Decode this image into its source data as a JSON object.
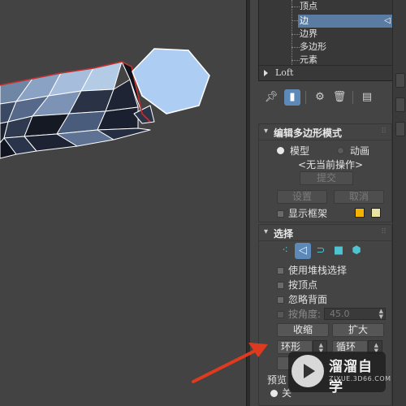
{
  "modifier_stack": {
    "items": [
      {
        "label": "顶点",
        "selected": false
      },
      {
        "label": "边",
        "selected": true
      },
      {
        "label": "边界",
        "selected": false
      },
      {
        "label": "多边形",
        "selected": false
      },
      {
        "label": "元素",
        "selected": false
      }
    ],
    "base_object": "Loft"
  },
  "toolbar": {
    "icons": [
      "pin-stack-icon",
      "show-end-result-icon",
      "make-unique-icon",
      "remove-modifier-icon",
      "configure-modifier-sets-icon"
    ]
  },
  "edit_poly_mode": {
    "title": "编辑多边形模式",
    "model_label": "模型",
    "model_selected": true,
    "animate_label": "动画",
    "no_current_operation": "<无当前操作>",
    "commit_label": "提交",
    "settings_label": "设置",
    "cancel_label": "取消",
    "show_cage_label": "显示框架",
    "cage_colors": [
      "#f5b301",
      "#e8e3a0"
    ]
  },
  "selection": {
    "title": "选择",
    "mode_icons": [
      "vertex-mode-icon",
      "edge-mode-icon",
      "border-mode-icon",
      "polygon-mode-icon",
      "element-mode-icon"
    ],
    "active_mode": "edge",
    "use_stack_selection": "使用堆栈选择",
    "by_vertex": "按顶点",
    "ignore_backfacing": "忽略背面",
    "by_angle": "按角度:",
    "angle_value": "45.0",
    "shrink_label": "收缩",
    "grow_label": "扩大",
    "ring_label": "环形",
    "loop_label": "循环",
    "preview_label": "预览",
    "off_label": "关"
  },
  "watermark": {
    "title": "溜溜自学",
    "subtitle": "ZIXUE.3D66.COM"
  },
  "colors": {
    "viewport_bg": "#434343",
    "panel_bg": "#444444",
    "selection_highlight": "#5a7ca3",
    "mesh_highlight": "#c23030",
    "arrow": "#e03a1e",
    "hexagon": "#aecdf2"
  }
}
